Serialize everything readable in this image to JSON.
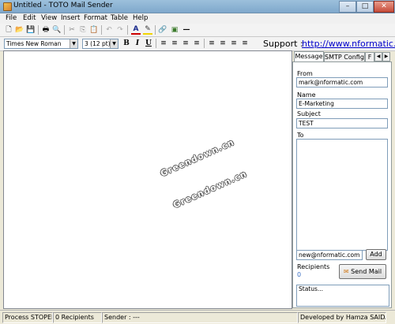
{
  "window": {
    "title": "Untitled - TOTO Mail Sender",
    "controls": {
      "minimize": "–",
      "maximize": "□",
      "close": "✕"
    }
  },
  "menu": [
    "File",
    "Edit",
    "View",
    "Insert",
    "Format",
    "Table",
    "Help"
  ],
  "toolbar": {
    "icons": [
      "new-document-icon",
      "open-folder-icon",
      "save-icon",
      "print-icon",
      "print-preview-icon",
      "cut-icon",
      "copy-icon",
      "paste-icon",
      "undo-icon",
      "redo-icon",
      "font-color-icon",
      "highlight-icon",
      "insert-link-icon",
      "insert-image-icon",
      "horizontal-line-icon"
    ],
    "glyphs": {
      "new": "🗋",
      "open": "📂",
      "save": "💾",
      "print": "🖶",
      "preview": "🔍",
      "cut": "✂",
      "copy": "⎘",
      "paste": "📋",
      "undo": "↶",
      "redo": "↷",
      "font_color": "A",
      "highlight": "✎",
      "link": "🔗",
      "image": "▣",
      "hr": "—"
    }
  },
  "format": {
    "font": "Times New Roman",
    "size": "3 (12 pt)",
    "bold": "B",
    "italic": "I",
    "underline": "U",
    "list_glyph": "≡",
    "align_glyph": "≡"
  },
  "support": {
    "label": "Support :",
    "link": "http://www.nformatic.com"
  },
  "watermark": [
    "Greendown.cn",
    "Greendown.cn"
  ],
  "tabs": [
    {
      "label": "Message",
      "active": true
    },
    {
      "label": "SMTP Config.",
      "active": false
    },
    {
      "label": "F",
      "active": false
    }
  ],
  "tab_arrows": {
    "left": "◀",
    "right": "▶"
  },
  "form": {
    "from_label": "From",
    "from_value": "mark@nformatic.com",
    "name_label": "Name",
    "name_value": "E-Marketing",
    "subject_label": "Subject",
    "subject_value": "TEST",
    "to_label": "To",
    "add_input": "new@nformatic.com",
    "add_button": "Add",
    "recipients_label": "Recipients",
    "recipients_count": "0",
    "send_button": "Send Mail",
    "status_text": "Status..."
  },
  "statusbar": {
    "process": "Process STOPED",
    "recipients": "0 Recipients",
    "sender": "Sender : ---",
    "developer": "Developed by Hamza SAIDA"
  },
  "colors": {
    "link": "#0000cc",
    "accent_count": "#3a6fc4",
    "font_color_red": "#cc0000",
    "highlight_yellow": "#f2d400"
  }
}
